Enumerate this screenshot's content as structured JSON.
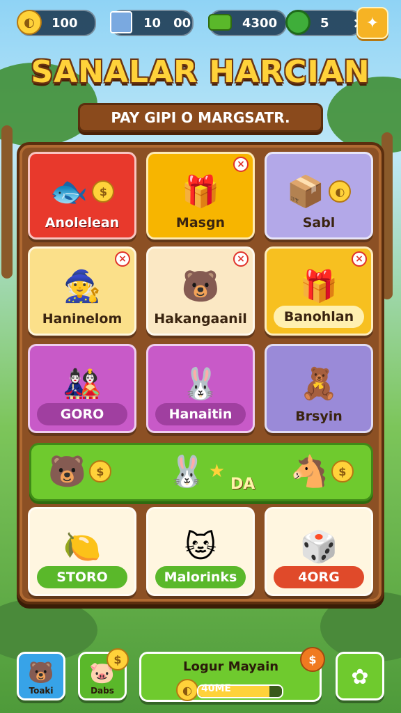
{
  "topbar": {
    "coins": "100",
    "cards": "10",
    "cards_extra": "00",
    "gems": "4300",
    "rank": "5",
    "close": "×"
  },
  "title": "SANALAR HARCIAN",
  "subtitle": "PAY GIPI O MARGSATR.",
  "board": {
    "row1": [
      {
        "label": "Anolelean",
        "color": "#e8392c"
      },
      {
        "label": "Masgn",
        "color": "#f7b500"
      },
      {
        "label": "Sabl",
        "color": "#b3a8e8"
      }
    ],
    "row2": [
      {
        "label": "Haninelom",
        "color": "#fbe08a"
      },
      {
        "label": "Hakangaanil",
        "color": "#fbe8c4"
      },
      {
        "label": "Banohlan",
        "color": "#f7c020"
      }
    ],
    "row3": [
      {
        "label": "GORO",
        "color": "#c85ac8"
      },
      {
        "label": "Hanaitin",
        "color": "#c85ac8"
      },
      {
        "label": "Brsyin",
        "color": "#9a8ad8"
      }
    ],
    "wide_label": "DA",
    "row4": [
      {
        "label": "STORO",
        "color": "#5ab82a"
      },
      {
        "label": "Malorinks",
        "color": "#5ab82a"
      },
      {
        "label": "4ORG",
        "color": "#e04a2a"
      }
    ]
  },
  "bottom": {
    "btn1": "Toaki",
    "btn2": "Dabs",
    "main_title": "Logur Mayain",
    "main_value": "40ME",
    "progress": 0.85
  },
  "icons": {
    "coin": "coin-icon",
    "cards": "calendar-icon",
    "gem": "cash-icon",
    "rank": "badge-icon",
    "gear": "puzzle-icon"
  }
}
